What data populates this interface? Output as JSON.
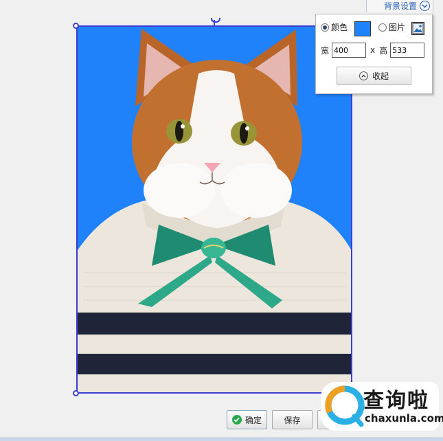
{
  "panel": {
    "title": "背景设置",
    "color_option_label": "颜色",
    "color_option_selected": true,
    "image_option_label": "图片",
    "image_option_selected": false,
    "background_color": "#1f82fb",
    "width_label": "宽",
    "width_value": "400",
    "separator": "x",
    "height_label": "高",
    "height_value": "533",
    "collapse_label": "收起"
  },
  "actions": {
    "confirm_label": "确定",
    "save_label": "保存",
    "third_label": ""
  },
  "watermark": {
    "brand_cn": "查询啦",
    "brand_en": "chaxunla.com"
  },
  "icons": {
    "collapse_tab": "chevron-down-circle-icon",
    "collapse_button": "chevron-up-circle-icon",
    "confirm": "check-circle-icon",
    "image_picker": "image-icon"
  }
}
